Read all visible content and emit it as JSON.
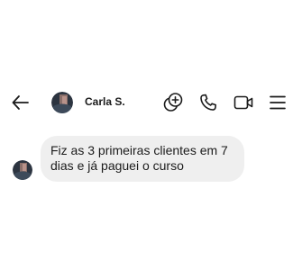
{
  "header": {
    "back_icon": "arrow-left-icon",
    "contact_name": "Carla S.",
    "actions": [
      {
        "name": "coin-exchange",
        "icon": "coins-plus-icon"
      },
      {
        "name": "voice-call",
        "icon": "phone-icon"
      },
      {
        "name": "video-call",
        "icon": "video-camera-icon"
      },
      {
        "name": "menu",
        "icon": "hamburger-menu-icon"
      }
    ]
  },
  "messages": [
    {
      "sender": "Carla S.",
      "direction": "incoming",
      "text": "Fiz as 3 primeiras clientes em 7 dias e já paguei o curso"
    }
  ],
  "colors": {
    "bubble_background": "#efefef",
    "text": "#1c1c1c",
    "icons": "#1a1a1a"
  }
}
